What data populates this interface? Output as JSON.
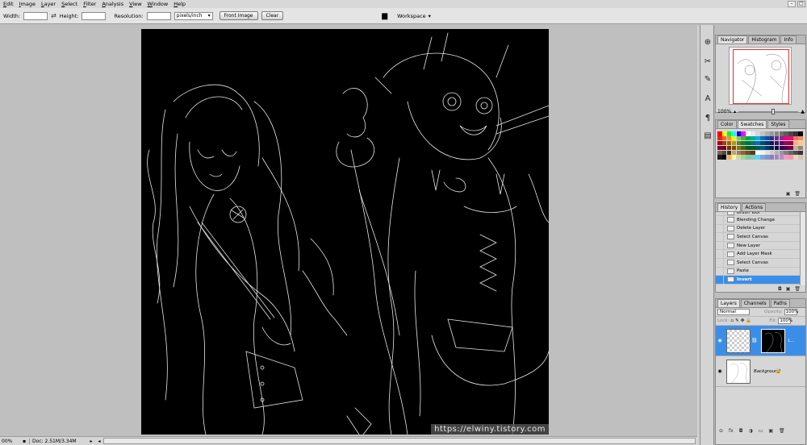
{
  "menubar": {
    "items": [
      "Edit",
      "Image",
      "Layer",
      "Select",
      "Filter",
      "Analysis",
      "View",
      "Window",
      "Help"
    ]
  },
  "window_controls": [
    "–",
    "□"
  ],
  "options_bar": {
    "width_label": "Width:",
    "width_value": "",
    "height_label": "Height:",
    "height_value": "",
    "resolution_label": "Resolution:",
    "resolution_value": "",
    "units": "pixels/inch",
    "front_image_label": "Front Image",
    "clear_label": "Clear",
    "workspace_label": "Workspace"
  },
  "canvas": {
    "watermark": "https://elwiny.tistory.com"
  },
  "status_bar": {
    "zoom": "00%",
    "doc_info": "Doc: 2.51M/3.34M"
  },
  "dock_icons": [
    "navigator-panel-icon",
    "tools-panel-icon",
    "brushes-panel-icon",
    "character-panel-icon",
    "paragraph-panel-icon",
    "layer-comps-panel-icon"
  ],
  "navigator_panel": {
    "tabs": [
      {
        "label": "Navigator",
        "active": true
      },
      {
        "label": "Histogram",
        "active": false
      },
      {
        "label": "Info",
        "active": false
      }
    ],
    "zoom": "100%"
  },
  "swatches_panel": {
    "tabs": [
      {
        "label": "Color",
        "active": false
      },
      {
        "label": "Swatches",
        "active": true
      },
      {
        "label": "Styles",
        "active": false
      }
    ],
    "colors": [
      "#ff0000",
      "#ffff00",
      "#00ff00",
      "#00ffff",
      "#0000ff",
      "#ff00ff",
      "#ffffff",
      "#ebebeb",
      "#d6d6d6",
      "#c2c2c2",
      "#adadad",
      "#999999",
      "#858585",
      "#707070",
      "#5c5c5c",
      "#474747",
      "#333333",
      "#000000",
      "#ed1c24",
      "#f26522",
      "#f7941d",
      "#fff200",
      "#8dc63f",
      "#39b54a",
      "#00a651",
      "#00a99d",
      "#00aeef",
      "#0072bc",
      "#0054a6",
      "#2e3192",
      "#662d91",
      "#92278f",
      "#ec008c",
      "#ed145b",
      "#f26d7d",
      "#f68e56",
      "#9e0b0f",
      "#a0410d",
      "#a3620a",
      "#aba000",
      "#598527",
      "#1a7b30",
      "#007236",
      "#00746b",
      "#0076a3",
      "#004a80",
      "#003471",
      "#1b1464",
      "#440e62",
      "#630460",
      "#9e005d",
      "#9e0039",
      "#f9ad81",
      "#fdc68a",
      "#7b0046",
      "#790000",
      "#7b2e00",
      "#7d4900",
      "#827b00",
      "#406618",
      "#005e20",
      "#005826",
      "#005952",
      "#005b7f",
      "#003663",
      "#002157",
      "#0d004c",
      "#32004b",
      "#4b0049",
      "#7b0046",
      "#c7b299",
      "#998675",
      "#736357",
      "#534741",
      "#37302a",
      "#c69c6d",
      "#a67c52",
      "#8c6239",
      "#754c24",
      "#603913",
      "#ffffff",
      "#f2f2f2",
      "#e0e0e0",
      "#cccccc",
      "#b3b3b3",
      "#999999",
      "#808080",
      "#666666",
      "#4d4d4d",
      "#333333",
      "#1a1a1a",
      "#000000",
      "#fbaf5d",
      "#fff799",
      "#c4df9b",
      "#a3d39c",
      "#82ca9d",
      "#7accc8",
      "#6dcff6",
      "#7da7d9",
      "#8393ca",
      "#8781bd",
      "#a186be",
      "#bd8cbf",
      "#f49ac1",
      "#f5989d",
      "#e2d5c3",
      "#d4c4b0"
    ]
  },
  "history_panel": {
    "tabs": [
      {
        "label": "History",
        "active": true
      },
      {
        "label": "Actions",
        "active": false
      }
    ],
    "items": [
      {
        "label": "Brush Tool",
        "selected": false
      },
      {
        "label": "Blending Change",
        "selected": false
      },
      {
        "label": "Delete Layer",
        "selected": false
      },
      {
        "label": "Select Canvas",
        "selected": false
      },
      {
        "label": "New Layer",
        "selected": false
      },
      {
        "label": "Add Layer Mask",
        "selected": false
      },
      {
        "label": "Select Canvas",
        "selected": false
      },
      {
        "label": "Paste",
        "selected": false
      },
      {
        "label": "Invert",
        "selected": true
      }
    ]
  },
  "layers_panel": {
    "tabs": [
      {
        "label": "Layers",
        "active": true
      },
      {
        "label": "Channels",
        "active": false
      },
      {
        "label": "Paths",
        "active": false
      }
    ],
    "blend_mode": "Normal",
    "opacity_label": "Opacity:",
    "opacity_value": "100%",
    "lock_label": "Lock:",
    "fill_label": "Fill:",
    "fill_value": "100%",
    "layers": [
      {
        "name": "L...",
        "selected": true
      },
      {
        "name": "Background",
        "selected": false
      }
    ],
    "footer_icons": [
      "link-icon",
      "fx-icon",
      "mask-icon",
      "adjustment-icon",
      "group-icon",
      "new-layer-icon",
      "trash-icon"
    ],
    "footer_labels": [
      "⊝",
      "fx",
      "◘",
      "◑",
      "▭",
      "▣",
      "🗑"
    ]
  }
}
